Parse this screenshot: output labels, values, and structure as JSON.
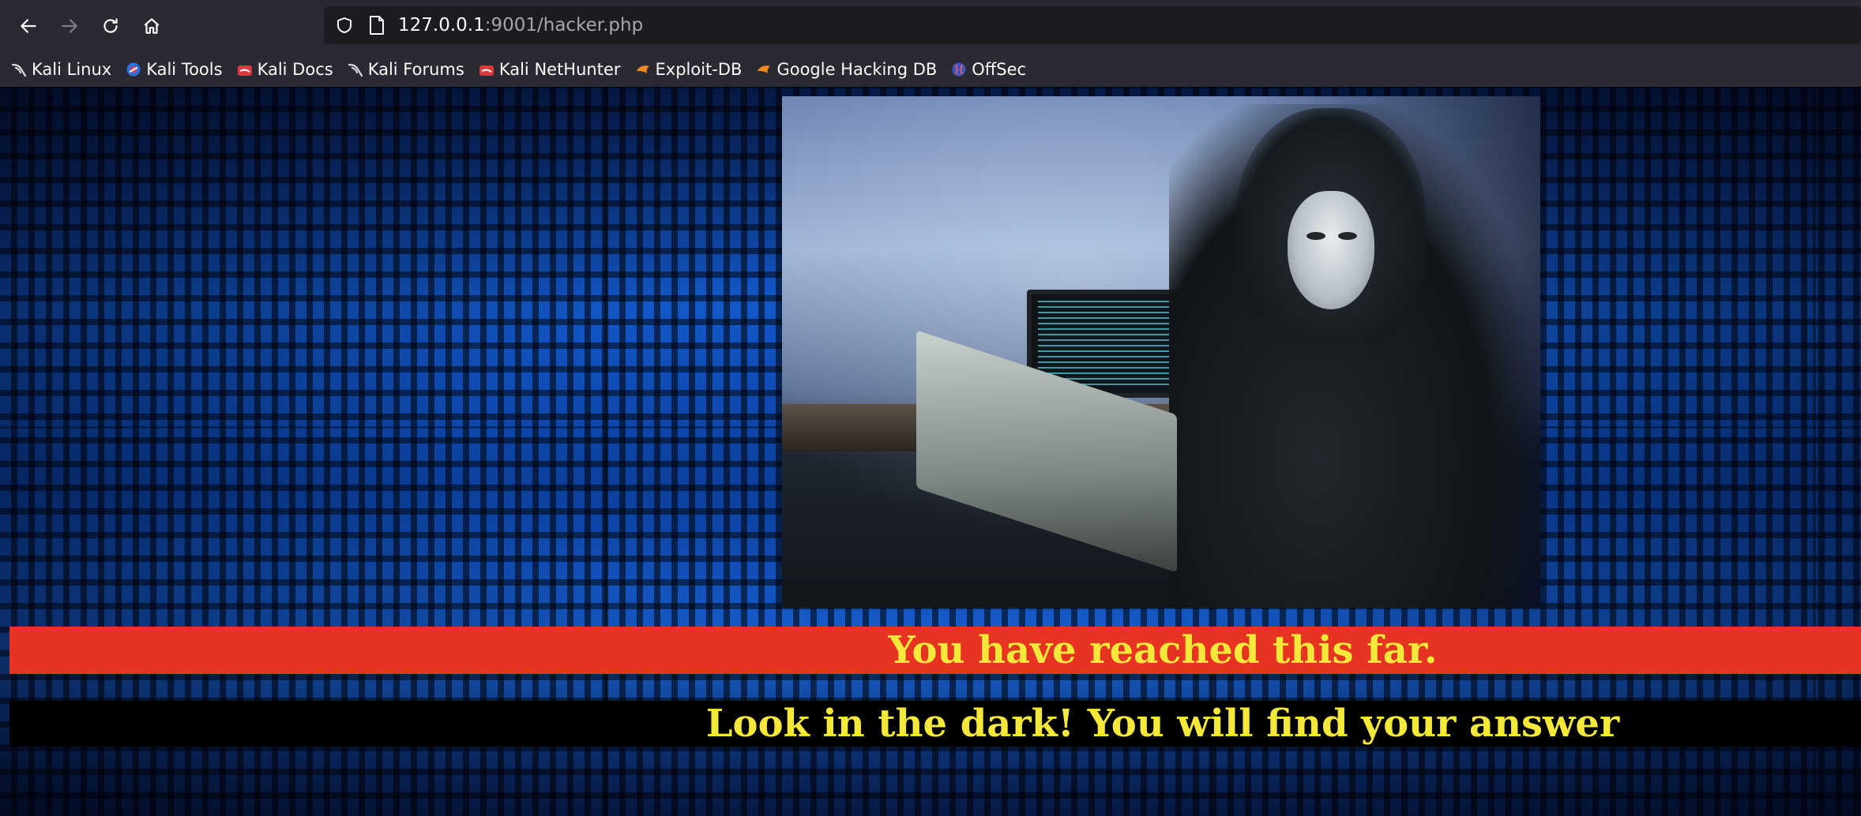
{
  "browser": {
    "nav": {
      "back_icon": "arrow-left-icon",
      "forward_icon": "arrow-right-icon",
      "reload_icon": "reload-icon",
      "home_icon": "home-icon"
    },
    "urlbar": {
      "host": "127.0.0.1",
      "rest": ":9001/hacker.php"
    },
    "bookmarks": [
      {
        "label": "Kali Linux",
        "icon": "kali-dragon-icon"
      },
      {
        "label": "Kali Tools",
        "icon": "kali-tools-icon"
      },
      {
        "label": "Kali Docs",
        "icon": "kali-docs-icon"
      },
      {
        "label": "Kali Forums",
        "icon": "kali-dragon-icon"
      },
      {
        "label": "Kali NetHunter",
        "icon": "kali-nethunter-icon"
      },
      {
        "label": "Exploit-DB",
        "icon": "exploit-db-icon"
      },
      {
        "label": "Google Hacking DB",
        "icon": "exploit-db-icon"
      },
      {
        "label": "OffSec",
        "icon": "offsec-icon"
      }
    ]
  },
  "page": {
    "banner_red": "You have reached this far.",
    "banner_black": "Look in the dark! You will find your answer",
    "colors": {
      "red_banner_bg": "#e63322",
      "banner_text": "#f4e93a",
      "black_banner_bg": "#000000"
    }
  }
}
